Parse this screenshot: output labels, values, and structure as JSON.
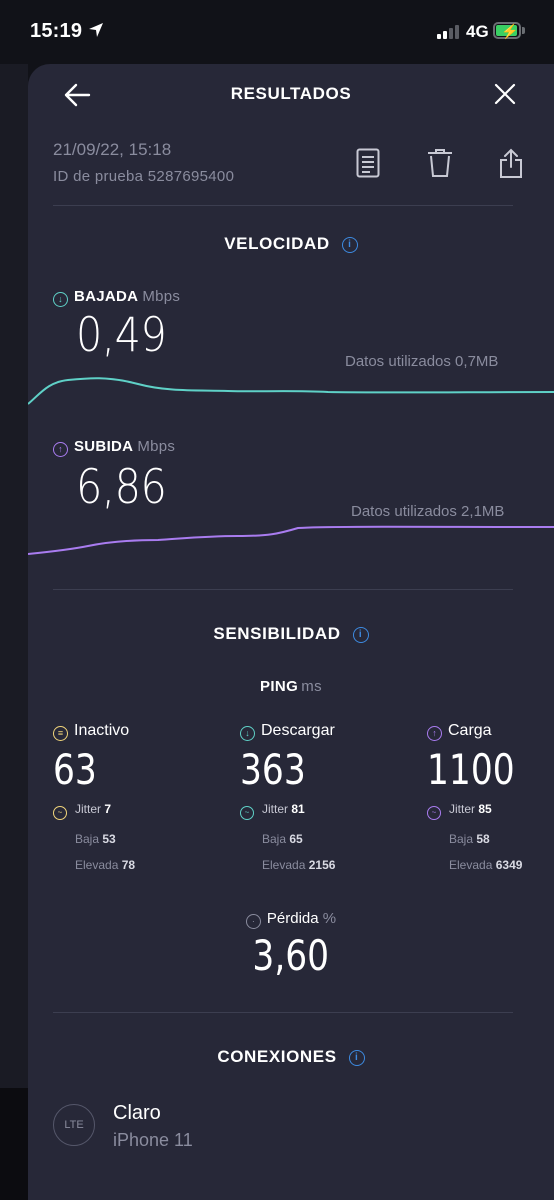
{
  "status_bar": {
    "time": "15:19",
    "network": "4G"
  },
  "header": {
    "title": "RESULTADOS"
  },
  "test_info": {
    "date": "21/09/22, 15:18",
    "test_id": "ID de prueba 5287695400"
  },
  "speed": {
    "title": "VELOCIDAD",
    "download": {
      "label": "BAJADA",
      "unit": "Mbps",
      "value": "0,49",
      "data_used": "Datos utilizados 0,7MB",
      "color": "#5fd1c7"
    },
    "upload": {
      "label": "SUBIDA",
      "unit": "Mbps",
      "value": "6,86",
      "data_used": "Datos utilizados 2,1MB",
      "color": "#a97cf0"
    }
  },
  "sensitivity": {
    "title": "SENSIBILIDAD",
    "ping_label": "PING",
    "ping_unit": "ms",
    "columns": [
      {
        "label": "Inactivo",
        "value": "63",
        "jitter_label": "Jitter",
        "jitter": "7",
        "low_label": "Baja",
        "low": "53",
        "high_label": "Elevada",
        "high": "78",
        "color": "#f0d47a"
      },
      {
        "label": "Descargar",
        "value": "363",
        "jitter_label": "Jitter",
        "jitter": "81",
        "low_label": "Baja",
        "low": "65",
        "high_label": "Elevada",
        "high": "2156",
        "color": "#5fd1c7"
      },
      {
        "label": "Carga",
        "value": "1100",
        "jitter_label": "Jitter",
        "jitter": "85",
        "low_label": "Baja",
        "low": "58",
        "high_label": "Elevada",
        "high": "6349",
        "color": "#a97cf0"
      }
    ],
    "loss_label": "Pérdida",
    "loss_unit": "%",
    "loss_value": "3,60"
  },
  "connections": {
    "title": "CONEXIONES",
    "badge": "LTE",
    "carrier": "Claro",
    "device": "iPhone 11"
  }
}
